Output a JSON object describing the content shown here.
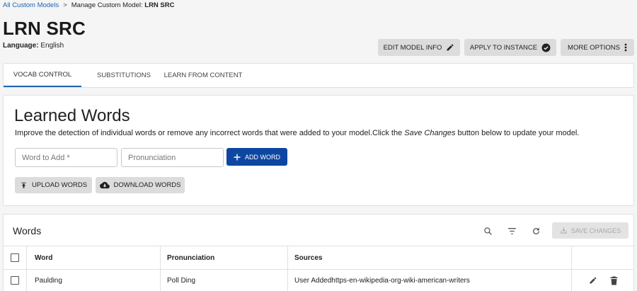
{
  "breadcrumb": {
    "root": "All Custom Models",
    "separator": ">",
    "current_prefix": "Manage Custom Model:",
    "current_name": "LRN SRC"
  },
  "header": {
    "title": "LRN SRC",
    "language_label": "Language:",
    "language_value": "English",
    "buttons": {
      "edit": {
        "label": "EDIT MODEL INFO",
        "icon": "pencil-icon"
      },
      "apply": {
        "label": "APPLY TO INSTANCE",
        "icon": "check-circle-icon"
      },
      "more": {
        "label": "MORE OPTIONS",
        "icon": "more-vertical-icon"
      }
    }
  },
  "tabs": [
    {
      "label": "VOCAB CONTROL",
      "active": true
    },
    {
      "label": "SUBSTITUTIONS",
      "active": false
    },
    {
      "label": "LEARN FROM CONTENT",
      "active": false
    }
  ],
  "learned_words": {
    "title": "Learned Words",
    "desc_before": "Improve the detection of individual words or remove any incorrect words that were added to your model.Click the ",
    "desc_emphasis": "Save Changes",
    "desc_after": " button below to update your model.",
    "word_placeholder": "Word to Add *",
    "pronunciation_placeholder": "Pronunciation",
    "add_button": {
      "label": "ADD WORD",
      "icon": "plus-icon"
    },
    "upload_button": {
      "label": "UPLOAD WORDS",
      "icon": "upload-icon"
    },
    "download_button": {
      "label": "DOWNLOAD WORDS",
      "icon": "cloud-download-icon"
    }
  },
  "words_table": {
    "title": "Words",
    "toolbar_icons": [
      "search-icon",
      "filter-icon",
      "refresh-icon"
    ],
    "save_button": {
      "label": "SAVE CHANGES",
      "icon": "save-icon",
      "disabled": true
    },
    "columns": [
      "Word",
      "Pronunciation",
      "Sources"
    ],
    "rows": [
      {
        "word": "Paulding",
        "pronunciation": "Poll Ding",
        "sources": "User Addedhttps-en-wikipedia-org-wiki-american-writers"
      }
    ],
    "row_actions": [
      "edit-icon",
      "delete-icon"
    ]
  },
  "colors": {
    "accent": "#1e63b5",
    "primary_button": "#0d47a1",
    "button_gray": "#dcdcdc",
    "background": "#f5f5f5"
  }
}
